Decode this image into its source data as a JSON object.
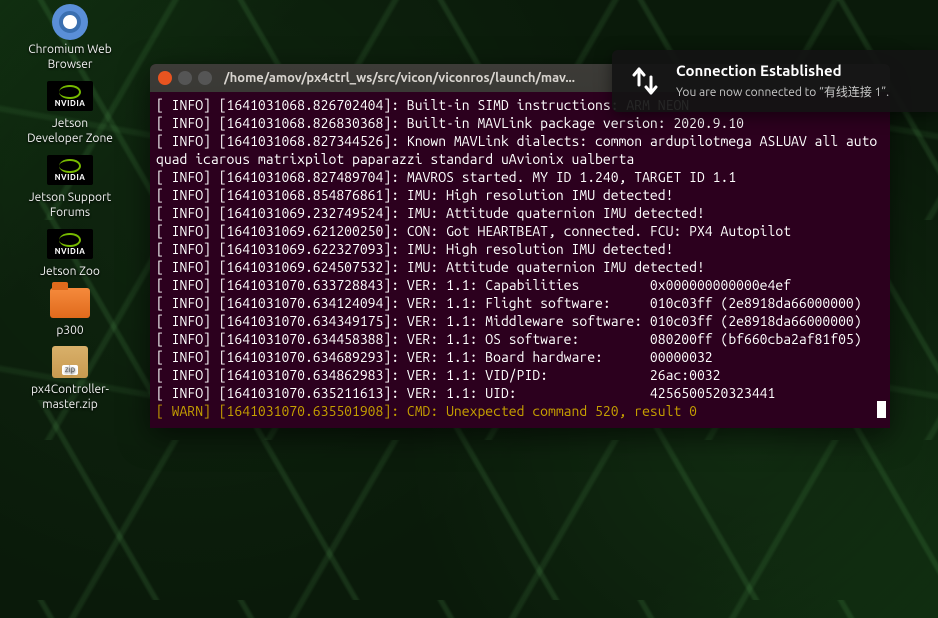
{
  "desktop": {
    "icons": [
      {
        "type": "chromium",
        "label": "Chromium Web Browser"
      },
      {
        "type": "nvidia",
        "label": "Jetson Developer Zone"
      },
      {
        "type": "nvidia",
        "label": "Jetson Support Forums"
      },
      {
        "type": "nvidia",
        "label": "Jetson Zoo"
      },
      {
        "type": "folder",
        "label": "p300"
      },
      {
        "type": "archive",
        "label": "px4Controller-master.zip",
        "zip": "zip"
      }
    ]
  },
  "terminal": {
    "title": "/home/amov/px4ctrl_ws/src/vicon/viconros/launch/mav...",
    "lines": [
      {
        "level": "info",
        "ts": "1641031068.826702404",
        "msg": "Built-in SIMD instructions: ARM NEON"
      },
      {
        "level": "info",
        "ts": "1641031068.826830368",
        "msg": "Built-in MAVLink package version: 2020.9.10"
      },
      {
        "level": "info",
        "ts": "1641031068.827344526",
        "msg": "Known MAVLink dialects: common ardupilotmega ASLUAV all autoquad icarous matrixpilot paparazzi standard uAvionix ualberta"
      },
      {
        "level": "info",
        "ts": "1641031068.827489704",
        "msg": "MAVROS started. MY ID 1.240, TARGET ID 1.1"
      },
      {
        "level": "info",
        "ts": "1641031068.854876861",
        "msg": "IMU: High resolution IMU detected!"
      },
      {
        "level": "info",
        "ts": "1641031069.232749524",
        "msg": "IMU: Attitude quaternion IMU detected!"
      },
      {
        "level": "info",
        "ts": "1641031069.621200250",
        "msg": "CON: Got HEARTBEAT, connected. FCU: PX4 Autopilot"
      },
      {
        "level": "info",
        "ts": "1641031069.622327093",
        "msg": "IMU: High resolution IMU detected!"
      },
      {
        "level": "info",
        "ts": "1641031069.624507532",
        "msg": "IMU: Attitude quaternion IMU detected!"
      },
      {
        "level": "info",
        "ts": "1641031070.633728843",
        "msg": "VER: 1.1: Capabilities         0x000000000000e4ef"
      },
      {
        "level": "info",
        "ts": "1641031070.634124094",
        "msg": "VER: 1.1: Flight software:     010c03ff (2e8918da66000000)"
      },
      {
        "level": "info",
        "ts": "1641031070.634349175",
        "msg": "VER: 1.1: Middleware software: 010c03ff (2e8918da66000000)"
      },
      {
        "level": "info",
        "ts": "1641031070.634458388",
        "msg": "VER: 1.1: OS software:         080200ff (bf660cba2af81f05)"
      },
      {
        "level": "info",
        "ts": "1641031070.634689293",
        "msg": "VER: 1.1: Board hardware:      00000032"
      },
      {
        "level": "info",
        "ts": "1641031070.634862983",
        "msg": "VER: 1.1: VID/PID:             26ac:0032"
      },
      {
        "level": "info",
        "ts": "1641031070.635211613",
        "msg": "VER: 1.1: UID:                 4256500520323441"
      },
      {
        "level": "warn",
        "ts": "1641031070.635501908",
        "msg": "CMD: Unexpected command 520, result 0"
      }
    ]
  },
  "notification": {
    "title": "Connection Established",
    "body": "You are now connected to “有线连接 1”."
  },
  "nvidia_text": "NVIDIA"
}
